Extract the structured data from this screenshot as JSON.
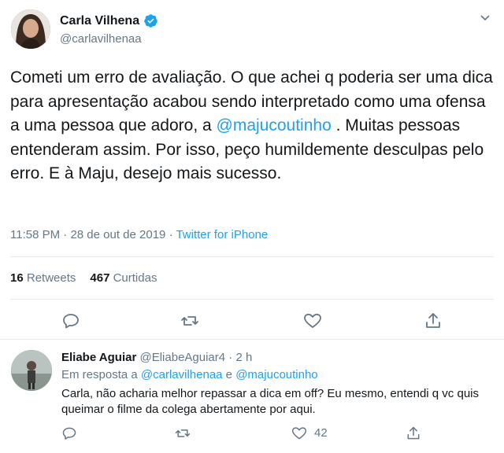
{
  "tweet": {
    "author_name": "Carla Vilhena",
    "handle": "@carlavilhenaa",
    "text_parts": {
      "p1": "Cometi um erro de avaliação. O que achei q poderia ser uma dica para apresentação acabou sendo interpretado como uma ofensa a uma pessoa que adoro, a ",
      "mention": "@majucoutinho",
      "p2": " . Muitas pessoas entenderam assim. Por isso, peço humildemente desculpas pelo erro. E à Maju, desejo mais sucesso."
    },
    "time": "11:58 PM",
    "separator": "·",
    "date": "28 de out de 2019",
    "source": "Twitter for iPhone",
    "retweets_count": "16",
    "retweets_label": "Retweets",
    "likes_count": "467",
    "likes_label": "Curtidas",
    "accent_color": "#1da1f2",
    "verified_color": "#1da1f2"
  },
  "reply": {
    "author_name": "Eliabe Aguiar",
    "handle": "@EliabeAguiar4",
    "dot": "·",
    "time": "2 h",
    "in_reply_prefix": "Em resposta a ",
    "in_reply_mention1": "@carlavilhenaa",
    "in_reply_conj": " e ",
    "in_reply_mention2": "@majucoutinho",
    "text": "Carla, não acharia melhor repassar a dica em off? Eu mesmo, entendi q vc quis queimar o filme da colega abertamente por aqui.",
    "likes_count": "42"
  },
  "icons": [
    "verified-badge-icon",
    "chevron-down-icon",
    "reply-icon",
    "retweet-icon",
    "like-icon",
    "share-icon"
  ]
}
